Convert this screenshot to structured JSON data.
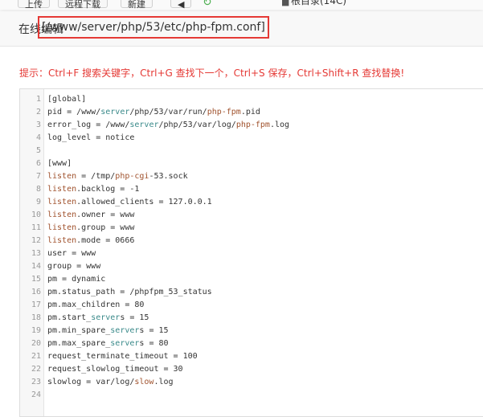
{
  "background_toolbar": {
    "upload_label": "上传",
    "remote_download_label": "远程下载",
    "new_label": "新建",
    "back_label": "◀",
    "folder_label": "根目录(14C)"
  },
  "dialog": {
    "title_prefix": "在线编辑",
    "title_path": "[/www/server/php/53/etc/php-fpm.conf]",
    "hint": "提示：Ctrl+F 搜索关键字，Ctrl+G 查找下一个，Ctrl+S 保存，Ctrl+Shift+R 查找替换!"
  },
  "editor": {
    "lines": [
      {
        "n": "1",
        "t": "[global]"
      },
      {
        "n": "2",
        "t": "pid = /www/server/php/53/var/run/php-fpm.pid"
      },
      {
        "n": "3",
        "t": "error_log = /www/server/php/53/var/log/php-fpm.log"
      },
      {
        "n": "4",
        "t": "log_level = notice"
      },
      {
        "n": "5",
        "t": ""
      },
      {
        "n": "6",
        "t": "[www]"
      },
      {
        "n": "7",
        "t": "listen = /tmp/php-cgi-53.sock"
      },
      {
        "n": "8",
        "t": "listen.backlog = -1"
      },
      {
        "n": "9",
        "t": "listen.allowed_clients = 127.0.0.1"
      },
      {
        "n": "10",
        "t": "listen.owner = www"
      },
      {
        "n": "11",
        "t": "listen.group = www"
      },
      {
        "n": "12",
        "t": "listen.mode = 0666"
      },
      {
        "n": "13",
        "t": "user = www"
      },
      {
        "n": "14",
        "t": "group = www"
      },
      {
        "n": "15",
        "t": "pm = dynamic"
      },
      {
        "n": "16",
        "t": "pm.status_path = /phpfpm_53_status"
      },
      {
        "n": "17",
        "t": "pm.max_children = 80"
      },
      {
        "n": "18",
        "t": "pm.start_servers = 15"
      },
      {
        "n": "19",
        "t": "pm.min_spare_servers = 15"
      },
      {
        "n": "20",
        "t": "pm.max_spare_servers = 80"
      },
      {
        "n": "21",
        "t": "request_terminate_timeout = 100"
      },
      {
        "n": "22",
        "t": "request_slowlog_timeout = 30"
      },
      {
        "n": "23",
        "t": "slowlog = var/log/slow.log"
      },
      {
        "n": "24",
        "t": ""
      }
    ]
  },
  "colors": {
    "hint_red": "#e53935",
    "highlight_border": "#e53935",
    "syntax_brown": "#a0522d",
    "syntax_teal": "#3a8a8a"
  }
}
